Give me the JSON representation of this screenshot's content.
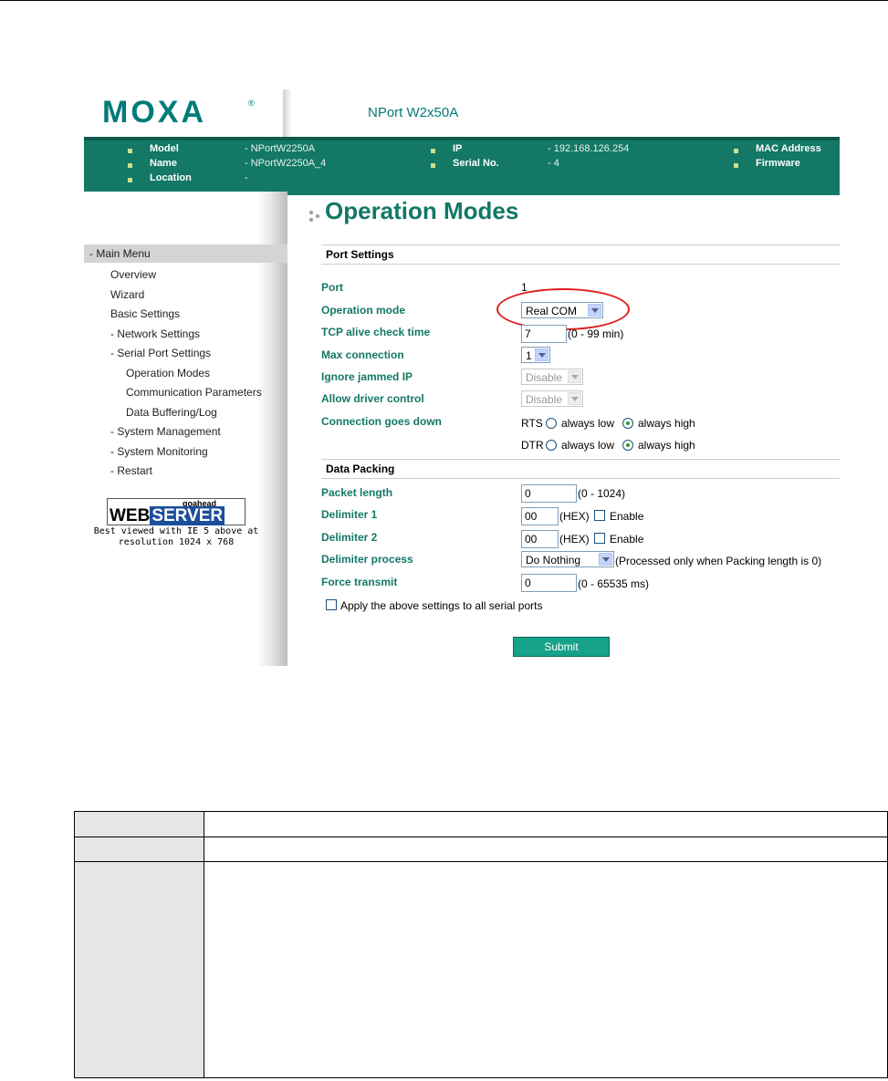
{
  "header": {
    "logo": "MOXA",
    "logo_mark": "®",
    "product": "NPort W2x50A"
  },
  "info": {
    "model_label": "Model",
    "model_value": "- NPortW2250A",
    "name_label": "Name",
    "name_value": "- NPortW2250A_4",
    "location_label": "Location",
    "location_value": "-",
    "ip_label": "IP",
    "ip_value": "- 192.168.126.254",
    "serial_label": "Serial No.",
    "serial_value": "- 4",
    "mac_label": "MAC Address",
    "firmware_label": "Firmware"
  },
  "menu": {
    "head": "- Main Menu",
    "items": [
      "Overview",
      "Wizard",
      "Basic Settings",
      "- Network Settings",
      "- Serial Port Settings",
      "Operation Modes",
      "Communication Parameters",
      "Data Buffering/Log",
      "- System Management",
      "- System Monitoring",
      "- Restart"
    ],
    "badge_top": "goahead",
    "badge_web": "WEB",
    "badge_server": "SERVER",
    "best_view_1": "Best viewed with IE 5 above at",
    "best_view_2": "resolution 1024 x 768"
  },
  "page": {
    "title": "Operation Modes",
    "port_settings": "Port Settings",
    "port_label": "Port",
    "port_value": "1",
    "op_mode_label": "Operation mode",
    "op_mode_value": "Real COM",
    "tcp_label": "TCP alive check time",
    "tcp_value": "7",
    "tcp_hint": "(0 - 99 min)",
    "maxconn_label": "Max connection",
    "maxconn_value": "1",
    "ignore_label": "Ignore jammed IP",
    "ignore_value": "Disable",
    "allow_label": "Allow driver control",
    "allow_value": "Disable",
    "conn_label": "Connection goes down",
    "rts": "RTS",
    "dtr": "DTR",
    "always_low": "always low",
    "always_high": "always high",
    "data_packing": "Data Packing",
    "packet_label": "Packet length",
    "packet_value": "0",
    "packet_hint": "(0 - 1024)",
    "delim1_label": "Delimiter 1",
    "delim1_value": "00",
    "delim2_label": "Delimiter 2",
    "delim2_value": "00",
    "hex": "(HEX)",
    "enable": "Enable",
    "delimproc_label": "Delimiter process",
    "delimproc_value": "Do Nothing",
    "delimproc_hint": "(Processed only when Packing length is 0)",
    "force_label": "Force transmit",
    "force_value": "0",
    "force_hint": "(0 - 65535 ms)",
    "apply_all": "Apply the above settings to all serial ports",
    "submit": "Submit"
  },
  "colors": {
    "accent": "#137866",
    "highlight": "#e01b1b"
  }
}
